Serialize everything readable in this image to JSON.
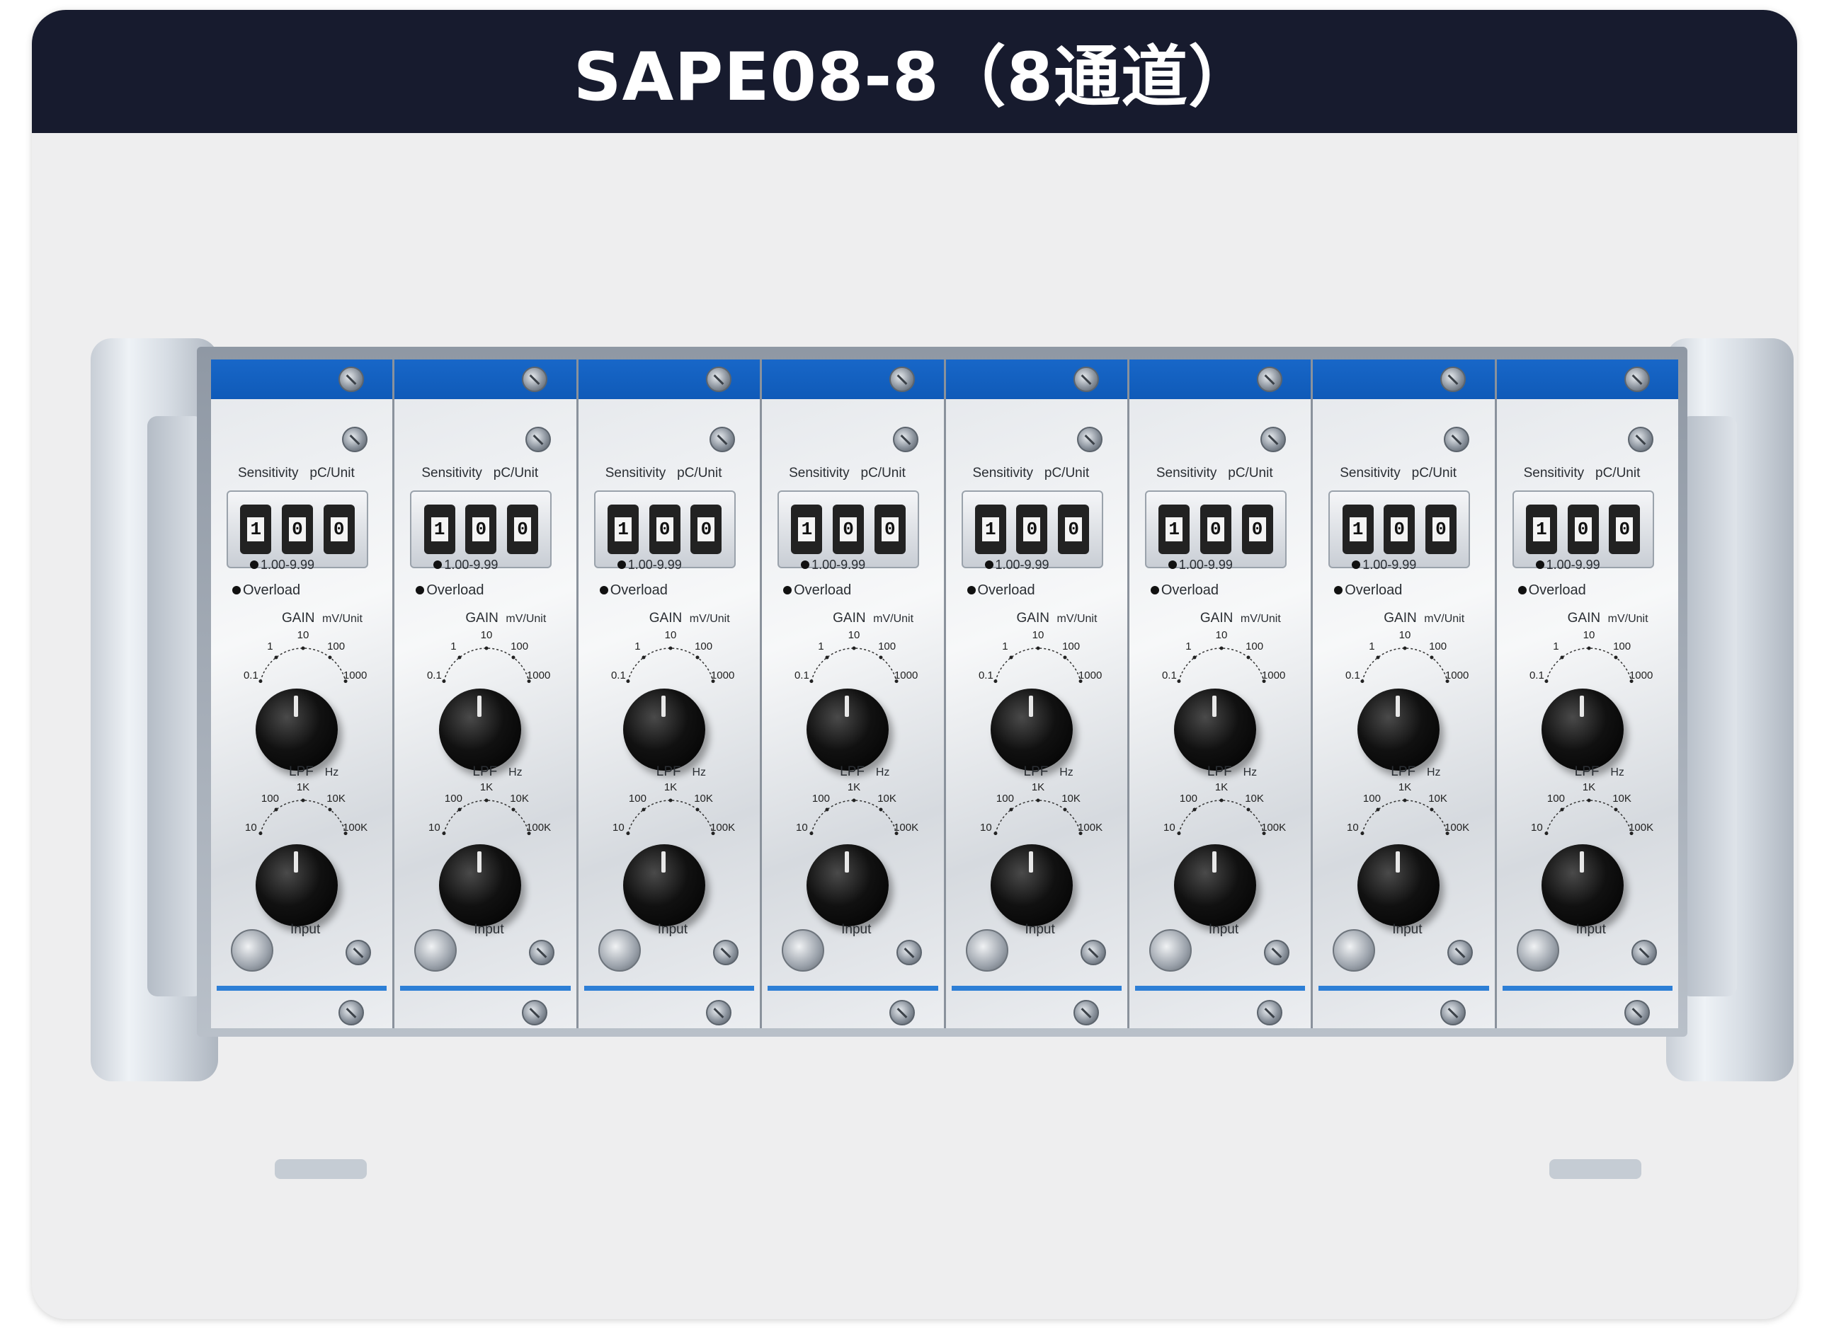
{
  "header": {
    "title": "SAPE08-8（8通道）"
  },
  "device": {
    "channel_count": 8,
    "channels": [
      {
        "sensitivity_label": "Sensitivity",
        "sensitivity_unit": "pC/Unit",
        "digits": [
          "1",
          "0",
          "0"
        ],
        "range": "1.00-9.99",
        "overload": "Overload",
        "gain_label": "GAIN",
        "gain_unit": "mV/Unit",
        "gain_ticks": [
          "0.1",
          "1",
          "10",
          "100",
          "1000"
        ],
        "lpf_label": "LPF",
        "lpf_unit": "Hz",
        "lpf_ticks": [
          "10",
          "100",
          "1K",
          "10K",
          "100K"
        ],
        "input": "Input"
      },
      {
        "sensitivity_label": "Sensitivity",
        "sensitivity_unit": "pC/Unit",
        "digits": [
          "1",
          "0",
          "0"
        ],
        "range": "1.00-9.99",
        "overload": "Overload",
        "gain_label": "GAIN",
        "gain_unit": "mV/Unit",
        "gain_ticks": [
          "0.1",
          "1",
          "10",
          "100",
          "1000"
        ],
        "lpf_label": "LPF",
        "lpf_unit": "Hz",
        "lpf_ticks": [
          "10",
          "100",
          "1K",
          "10K",
          "100K"
        ],
        "input": "Input"
      },
      {
        "sensitivity_label": "Sensitivity",
        "sensitivity_unit": "pC/Unit",
        "digits": [
          "1",
          "0",
          "0"
        ],
        "range": "1.00-9.99",
        "overload": "Overload",
        "gain_label": "GAIN",
        "gain_unit": "mV/Unit",
        "gain_ticks": [
          "0.1",
          "1",
          "10",
          "100",
          "1000"
        ],
        "lpf_label": "LPF",
        "lpf_unit": "Hz",
        "lpf_ticks": [
          "10",
          "100",
          "1K",
          "10K",
          "100K"
        ],
        "input": "Input"
      },
      {
        "sensitivity_label": "Sensitivity",
        "sensitivity_unit": "pC/Unit",
        "digits": [
          "1",
          "0",
          "0"
        ],
        "range": "1.00-9.99",
        "overload": "Overload",
        "gain_label": "GAIN",
        "gain_unit": "mV/Unit",
        "gain_ticks": [
          "0.1",
          "1",
          "10",
          "100",
          "1000"
        ],
        "lpf_label": "LPF",
        "lpf_unit": "Hz",
        "lpf_ticks": [
          "10",
          "100",
          "1K",
          "10K",
          "100K"
        ],
        "input": "Input"
      },
      {
        "sensitivity_label": "Sensitivity",
        "sensitivity_unit": "pC/Unit",
        "digits": [
          "1",
          "0",
          "0"
        ],
        "range": "1.00-9.99",
        "overload": "Overload",
        "gain_label": "GAIN",
        "gain_unit": "mV/Unit",
        "gain_ticks": [
          "0.1",
          "1",
          "10",
          "100",
          "1000"
        ],
        "lpf_label": "LPF",
        "lpf_unit": "Hz",
        "lpf_ticks": [
          "10",
          "100",
          "1K",
          "10K",
          "100K"
        ],
        "input": "Input"
      },
      {
        "sensitivity_label": "Sensitivity",
        "sensitivity_unit": "pC/Unit",
        "digits": [
          "1",
          "0",
          "0"
        ],
        "range": "1.00-9.99",
        "overload": "Overload",
        "gain_label": "GAIN",
        "gain_unit": "mV/Unit",
        "gain_ticks": [
          "0.1",
          "1",
          "10",
          "100",
          "1000"
        ],
        "lpf_label": "LPF",
        "lpf_unit": "Hz",
        "lpf_ticks": [
          "10",
          "100",
          "1K",
          "10K",
          "100K"
        ],
        "input": "Input"
      },
      {
        "sensitivity_label": "Sensitivity",
        "sensitivity_unit": "pC/Unit",
        "digits": [
          "1",
          "0",
          "0"
        ],
        "range": "1.00-9.99",
        "overload": "Overload",
        "gain_label": "GAIN",
        "gain_unit": "mV/Unit",
        "gain_ticks": [
          "0.1",
          "1",
          "10",
          "100",
          "1000"
        ],
        "lpf_label": "LPF",
        "lpf_unit": "Hz",
        "lpf_ticks": [
          "10",
          "100",
          "1K",
          "10K",
          "100K"
        ],
        "input": "Input"
      },
      {
        "sensitivity_label": "Sensitivity",
        "sensitivity_unit": "pC/Unit",
        "digits": [
          "1",
          "0",
          "0"
        ],
        "range": "1.00-9.99",
        "overload": "Overload",
        "gain_label": "GAIN",
        "gain_unit": "mV/Unit",
        "gain_ticks": [
          "0.1",
          "1",
          "10",
          "100",
          "1000"
        ],
        "lpf_label": "LPF",
        "lpf_unit": "Hz",
        "lpf_ticks": [
          "10",
          "100",
          "1K",
          "10K",
          "100K"
        ],
        "input": "Input"
      }
    ]
  },
  "colors": {
    "header_bg": "#171b2e",
    "panel_blue": "#1867c8",
    "card_bg": "#eeeeef"
  }
}
